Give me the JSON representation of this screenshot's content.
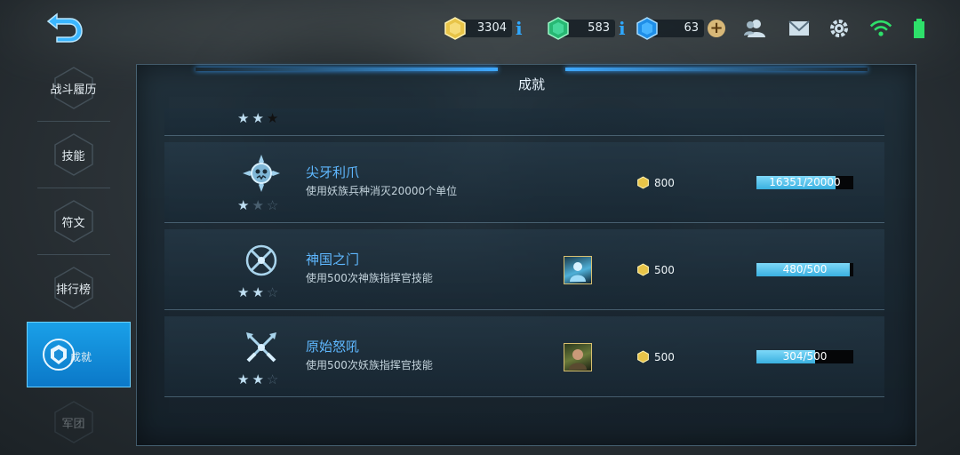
{
  "top_bar": {
    "resources": [
      {
        "name": "gold",
        "icon": "gold-crystal-icon",
        "value": "3304",
        "color": "#e8c448"
      },
      {
        "name": "emerald",
        "icon": "green-crystal-icon",
        "value": "583",
        "color": "#35d08a"
      },
      {
        "name": "diamond",
        "icon": "blue-crystal-icon",
        "value": "63",
        "color": "#3ab6ff"
      }
    ],
    "info_label": "i",
    "plus_label": "+"
  },
  "sidenav": {
    "items": [
      {
        "label": "战斗履历",
        "active": false
      },
      {
        "label": "技能",
        "active": false
      },
      {
        "label": "符文",
        "active": false
      },
      {
        "label": "排行榜",
        "active": false
      },
      {
        "label": "成就",
        "active": true
      },
      {
        "label": "军团",
        "active": false
      }
    ]
  },
  "panel": {
    "title": "成就"
  },
  "achievements": [
    {
      "name": "",
      "desc": "",
      "stars": 2,
      "max_stars": 3,
      "reward": "",
      "progress_text": "",
      "progress": 0
    },
    {
      "name": "尖牙利爪",
      "desc": "使用妖族兵种消灭20000个单位",
      "stars": 1,
      "max_stars": 3,
      "reward": "800",
      "progress_text": "16351/20000",
      "progress": 0.8176,
      "has_portrait": false
    },
    {
      "name": "神国之门",
      "desc": "使用500次神族指挥官技能",
      "stars": 2,
      "max_stars": 3,
      "reward": "500",
      "progress_text": "480/500",
      "progress": 0.96,
      "has_portrait": true
    },
    {
      "name": "原始怒吼",
      "desc": "使用500次妖族指挥官技能",
      "stars": 2,
      "max_stars": 3,
      "reward": "500",
      "progress_text": "304/500",
      "progress": 0.608,
      "has_portrait": true
    }
  ],
  "colors": {
    "accent": "#1aa0e8",
    "title_blue": "#5fb8ff",
    "progress_fill": "#3ab0e0"
  }
}
